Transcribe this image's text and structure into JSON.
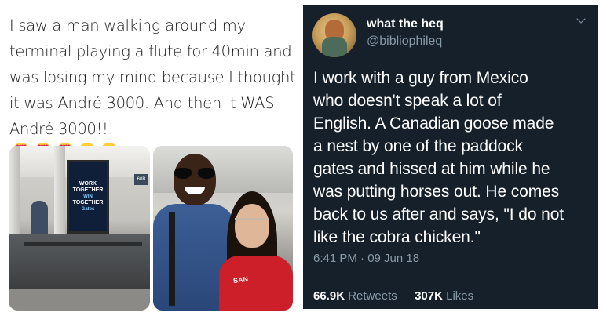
{
  "left_tweet": {
    "lines": [
      "I saw a man walking around my",
      "terminal playing a flute for 40min and",
      "was losing my mind because I thought",
      "it was André 3000. And then it WAS",
      "André 3000!!!"
    ],
    "emoji_icons": [
      "heart-eyes-emoji",
      "heart-eyes-emoji",
      "heart-eyes-emoji",
      "sob-emoji",
      "sob-emoji"
    ],
    "photo1": {
      "screen_line1": "WORK",
      "screen_line2": "TOGETHER",
      "screen_line3": "WIN",
      "screen_line4": "TOGETHER",
      "screen_line5": "Gates",
      "gate_sign": "60B"
    },
    "photo2": {
      "shirt_text": "SAN"
    }
  },
  "right_tweet": {
    "display_name": "what the heq",
    "handle": "@bibliophileq",
    "text_lines": [
      "I work with a guy from Mexico",
      "who doesn't speak a lot of",
      "English. A Canadian goose made",
      "a nest by one of the paddock",
      "gates and hissed at him while he",
      "was putting horses out. He comes",
      "back to us after and says, \"I do not",
      "like the cobra chicken.\""
    ],
    "timestamp": "6:41 PM · 09 Jun 18",
    "retweets_count": "66.9K",
    "retweets_label": "Retweets",
    "likes_count": "307K",
    "likes_label": "Likes",
    "colors": {
      "card_bg": "#15202b",
      "secondary_text": "#8899a6",
      "divider": "#38444d"
    }
  }
}
